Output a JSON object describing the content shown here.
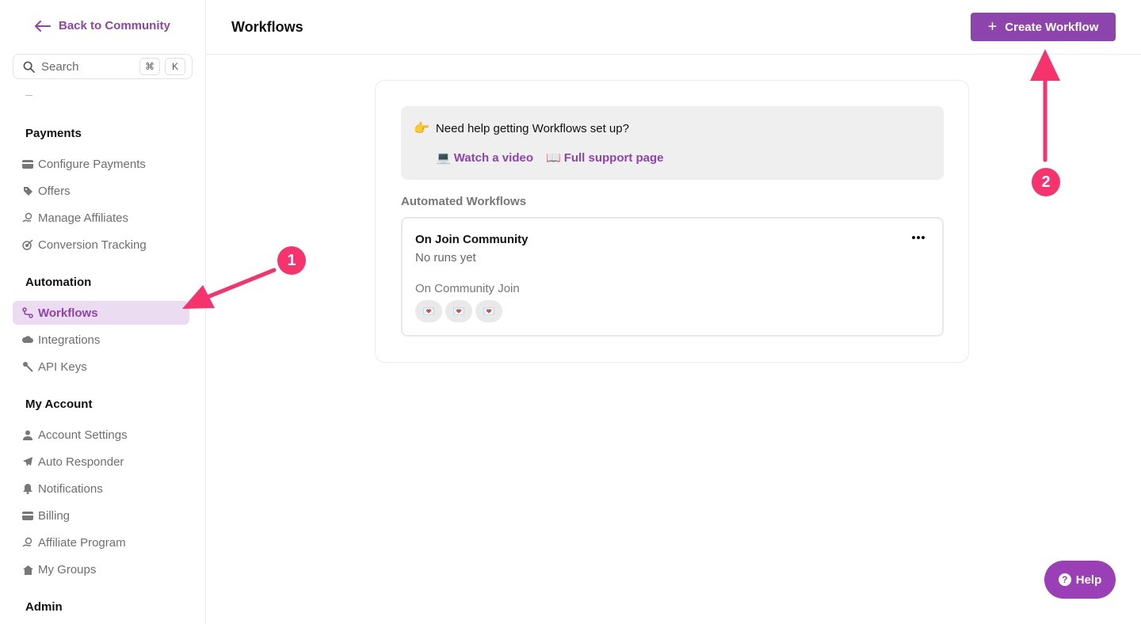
{
  "sidebar": {
    "back_label": "Back to Community",
    "search_placeholder": "Search",
    "search_kbd_1": "⌘",
    "search_kbd_2": "K",
    "sections": [
      {
        "title": "Payments"
      },
      {
        "title": "Automation"
      },
      {
        "title": "My Account"
      },
      {
        "title": "Admin"
      }
    ],
    "items": [
      {
        "label": "Configure Payments"
      },
      {
        "label": "Offers"
      },
      {
        "label": "Manage Affiliates"
      },
      {
        "label": "Conversion Tracking"
      },
      {
        "label": "Workflows"
      },
      {
        "label": "Integrations"
      },
      {
        "label": "API Keys"
      },
      {
        "label": "Account Settings"
      },
      {
        "label": "Auto Responder"
      },
      {
        "label": "Notifications"
      },
      {
        "label": "Billing"
      },
      {
        "label": "Affiliate Program"
      },
      {
        "label": "My Groups"
      }
    ]
  },
  "header": {
    "title": "Workflows",
    "create_label": "Create Workflow"
  },
  "help_box": {
    "question": "Need help getting Workflows set up?",
    "link_video": "Watch a video",
    "link_support": "Full support page"
  },
  "automated": {
    "title": "Automated Workflows",
    "workflow": {
      "name": "On Join Community",
      "runs": "No runs yet",
      "trigger": "On Community Join"
    }
  },
  "help_button": {
    "label": "Help"
  },
  "annotations": {
    "badge_1": "1",
    "badge_2": "2"
  },
  "colors": {
    "accent": "#8e44ad",
    "active_bg": "#ecdcf1",
    "annotation": "#f7336e"
  }
}
